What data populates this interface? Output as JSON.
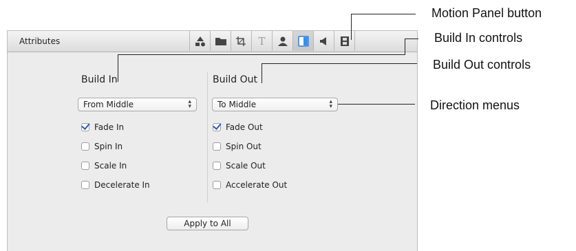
{
  "panel": {
    "title": "Attributes",
    "toolbar_icons": [
      "inspector-shapes-icon",
      "folder-icon",
      "crop-icon",
      "text-icon",
      "person-icon",
      "motion-icon",
      "speaker-icon",
      "film-icon"
    ],
    "active_tool": "motion-icon",
    "accent_color": "#2a7fd4"
  },
  "build_in": {
    "title": "Build In",
    "direction": "From Middle",
    "options": [
      {
        "label": "Fade In",
        "checked": true
      },
      {
        "label": "Spin In",
        "checked": false
      },
      {
        "label": "Scale In",
        "checked": false
      },
      {
        "label": "Decelerate In",
        "checked": false
      }
    ]
  },
  "build_out": {
    "title": "Build Out",
    "direction": "To Middle",
    "options": [
      {
        "label": "Fade Out",
        "checked": true
      },
      {
        "label": "Spin Out",
        "checked": false
      },
      {
        "label": "Scale Out",
        "checked": false
      },
      {
        "label": "Accelerate Out",
        "checked": false
      }
    ]
  },
  "apply_label": "Apply to All",
  "callouts": {
    "motion": "Motion Panel button",
    "build_in": "Build In controls",
    "build_out": "Build Out controls",
    "direction": "Direction menus"
  }
}
